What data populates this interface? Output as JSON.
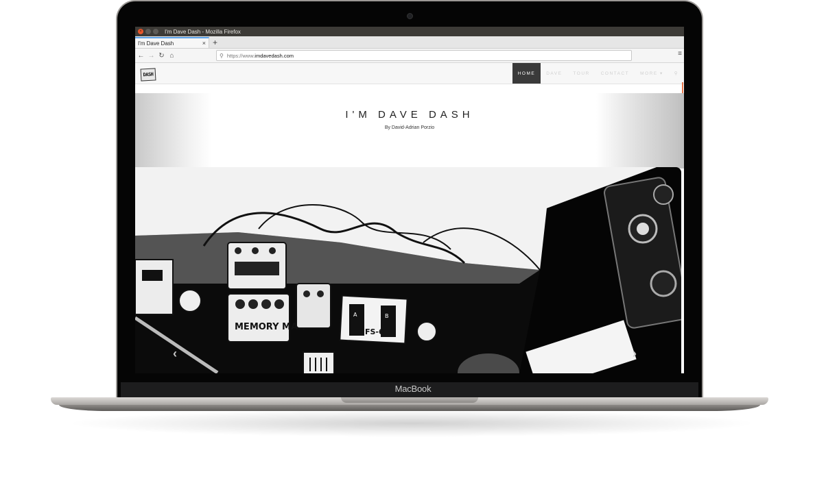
{
  "window": {
    "title": "I'm Dave Dash - Mozilla Firefox"
  },
  "browser": {
    "tab_label": "I'm Dave Dash",
    "tab_close": "×",
    "new_tab": "+",
    "url_prefix": "https://www.",
    "url_host": "imdavedash.com"
  },
  "site": {
    "logo_text": "DASH",
    "nav": [
      "HOME",
      "DAVE",
      "TOUR",
      "CONTACT",
      "MORE ▾"
    ],
    "title": "I'M DAVE DASH",
    "subtitle": "By David-Adrian Porzio"
  },
  "slider": {
    "pedal_labels": [
      "MEMORY MAN",
      "FS-6",
      "A",
      "B"
    ]
  },
  "device": {
    "label": "MacBook"
  },
  "icons": [
    "back-icon",
    "forward-icon",
    "reload-icon",
    "home-icon",
    "search-icon",
    "hamburger-menu-icon",
    "chevron-left-icon",
    "chevron-right-icon"
  ]
}
